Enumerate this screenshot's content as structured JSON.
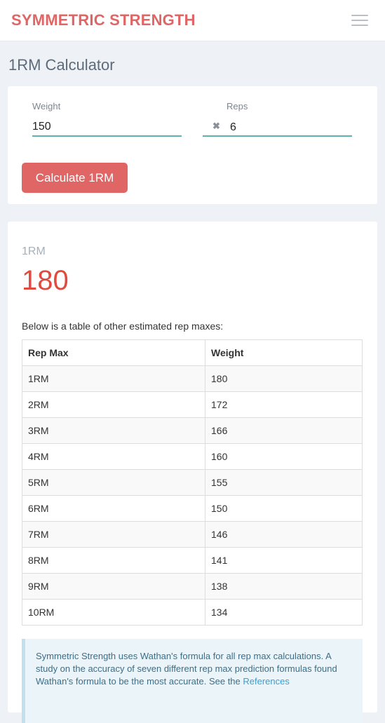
{
  "navbar": {
    "brand": "SYMMETRIC STRENGTH",
    "menu_icon": "hamburger-icon"
  },
  "page": {
    "title": "1RM Calculator"
  },
  "form": {
    "weight_label": "Weight",
    "weight_value": "150",
    "reps_label": "Reps",
    "reps_value": "6",
    "times_symbol": "✖",
    "calculate_label": "Calculate 1RM"
  },
  "result": {
    "label": "1RM",
    "value": "180",
    "intro": "Below is a table of other estimated rep maxes:"
  },
  "table": {
    "headers": [
      "Rep Max",
      "Weight"
    ],
    "rows": [
      [
        "1RM",
        "180"
      ],
      [
        "2RM",
        "172"
      ],
      [
        "3RM",
        "166"
      ],
      [
        "4RM",
        "160"
      ],
      [
        "5RM",
        "155"
      ],
      [
        "6RM",
        "150"
      ],
      [
        "7RM",
        "146"
      ],
      [
        "8RM",
        "141"
      ],
      [
        "9RM",
        "138"
      ],
      [
        "10RM",
        "134"
      ]
    ]
  },
  "info": {
    "text": "Symmetric Strength uses Wathan's formula for all rep max calculations. A study on the accuracy of seven different rep max prediction formulas found Wathan's formula to be the most accurate. See the ",
    "link": "References"
  },
  "colors": {
    "brand": "#e06666",
    "accent": "#5ab3ad",
    "result": "#e04a3f"
  }
}
